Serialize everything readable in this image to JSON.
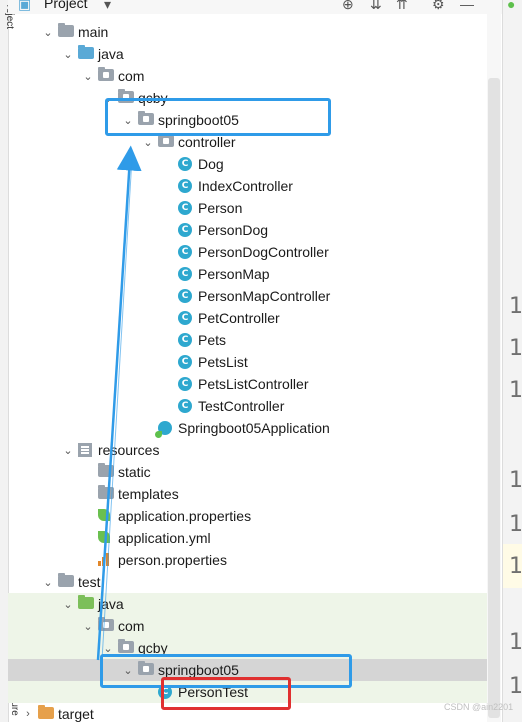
{
  "side_panel": {
    "top_label": "Project",
    "bottom_label": "Structure"
  },
  "header": {
    "title": "Project",
    "dropdown_icon": "caret-down-icon",
    "icons": [
      "locate-icon",
      "expand-all-icon",
      "collapse-all-icon",
      "settings-icon",
      "hide-icon"
    ]
  },
  "tree": [
    {
      "name": "main-folder",
      "label": "main",
      "depth": 1,
      "chevron": "open",
      "icon": "folder-grey"
    },
    {
      "name": "java-folder",
      "label": "java",
      "depth": 2,
      "chevron": "open",
      "icon": "folder-blue"
    },
    {
      "name": "package-com",
      "label": "com",
      "depth": 3,
      "chevron": "open",
      "icon": "package"
    },
    {
      "name": "package-qcby",
      "label": "qcby",
      "depth": 4,
      "chevron": "open",
      "icon": "package"
    },
    {
      "name": "package-springboot05",
      "label": "springboot05",
      "depth": 5,
      "chevron": "open",
      "icon": "package"
    },
    {
      "name": "package-controller",
      "label": "controller",
      "depth": 6,
      "chevron": "open",
      "icon": "package"
    },
    {
      "name": "class-dog",
      "label": "Dog",
      "depth": 7,
      "icon": "class"
    },
    {
      "name": "class-indexcontroller",
      "label": "IndexController",
      "depth": 7,
      "icon": "class"
    },
    {
      "name": "class-person",
      "label": "Person",
      "depth": 7,
      "icon": "class"
    },
    {
      "name": "class-persondog",
      "label": "PersonDog",
      "depth": 7,
      "icon": "class"
    },
    {
      "name": "class-persondogcontroller",
      "label": "PersonDogController",
      "depth": 7,
      "icon": "class"
    },
    {
      "name": "class-personmap",
      "label": "PersonMap",
      "depth": 7,
      "icon": "class"
    },
    {
      "name": "class-personmapcontroller",
      "label": "PersonMapController",
      "depth": 7,
      "icon": "class"
    },
    {
      "name": "class-petcontroller",
      "label": "PetController",
      "depth": 7,
      "icon": "class"
    },
    {
      "name": "class-pets",
      "label": "Pets",
      "depth": 7,
      "icon": "class"
    },
    {
      "name": "class-petslist",
      "label": "PetsList",
      "depth": 7,
      "icon": "class"
    },
    {
      "name": "class-petslistcontroller",
      "label": "PetsListController",
      "depth": 7,
      "icon": "class"
    },
    {
      "name": "class-testcontroller",
      "label": "TestController",
      "depth": 7,
      "icon": "class"
    },
    {
      "name": "class-springboot05application",
      "label": "Springboot05Application",
      "depth": 6,
      "icon": "app-class"
    },
    {
      "name": "resources-folder",
      "label": "resources",
      "depth": 2,
      "chevron": "open",
      "icon": "resources"
    },
    {
      "name": "folder-static",
      "label": "static",
      "depth": 3,
      "icon": "folder-grey"
    },
    {
      "name": "folder-templates",
      "label": "templates",
      "depth": 3,
      "icon": "folder-grey"
    },
    {
      "name": "file-application-properties",
      "label": "application.properties",
      "depth": 3,
      "icon": "leaf"
    },
    {
      "name": "file-application-yml",
      "label": "application.yml",
      "depth": 3,
      "icon": "leaf"
    },
    {
      "name": "file-person-properties",
      "label": "person.properties",
      "depth": 3,
      "icon": "chart"
    },
    {
      "name": "test-folder",
      "label": "test",
      "depth": 1,
      "chevron": "open",
      "icon": "folder-grey"
    },
    {
      "name": "test-java-folder",
      "label": "java",
      "depth": 2,
      "chevron": "open",
      "icon": "folder-green",
      "bg": "test"
    },
    {
      "name": "test-package-com",
      "label": "com",
      "depth": 3,
      "chevron": "open",
      "icon": "package",
      "bg": "test"
    },
    {
      "name": "test-package-qcby",
      "label": "qcby",
      "depth": 4,
      "chevron": "open",
      "icon": "package",
      "bg": "test"
    },
    {
      "name": "test-package-springboot05",
      "label": "springboot05",
      "depth": 5,
      "chevron": "open",
      "icon": "package",
      "bg": "sel"
    },
    {
      "name": "class-persontest",
      "label": "PersonTest",
      "depth": 6,
      "icon": "class",
      "bg": "test"
    },
    {
      "name": "target-folder",
      "label": "target",
      "depth": 0,
      "chevron": "closed",
      "icon": "folder-orange"
    }
  ],
  "gutter_numbers": [
    "1",
    "1",
    "1",
    "1",
    "1",
    "1",
    "1",
    "1"
  ],
  "class_badge": "C",
  "watermark": "CSDN @ain2201"
}
